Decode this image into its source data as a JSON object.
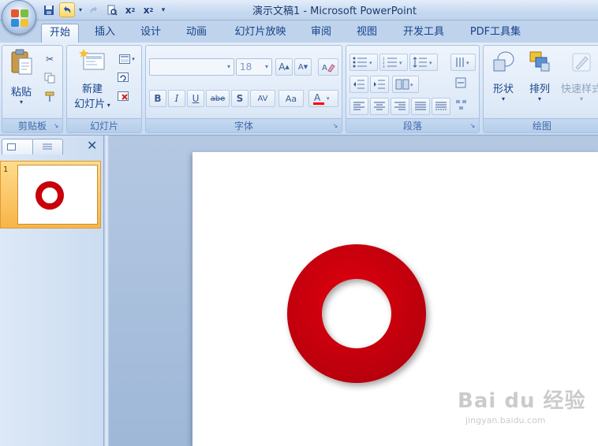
{
  "window": {
    "title": "演示文稿1 - Microsoft PowerPoint"
  },
  "quick_access": {
    "items": [
      {
        "name": "save-icon",
        "glyph": "▣"
      },
      {
        "name": "undo-icon",
        "glyph": "↶"
      },
      {
        "name": "redo-icon",
        "glyph": "↷"
      },
      {
        "name": "print-preview-icon",
        "glyph": "⌕"
      },
      {
        "name": "superscript-icon",
        "glyph": "x²"
      },
      {
        "name": "subscript-icon",
        "glyph": "x₂"
      },
      {
        "name": "customize-qat-icon",
        "glyph": "▾"
      }
    ]
  },
  "ribbon_tabs": [
    {
      "label": "开始",
      "active": true
    },
    {
      "label": "插入",
      "active": false
    },
    {
      "label": "设计",
      "active": false
    },
    {
      "label": "动画",
      "active": false
    },
    {
      "label": "幻灯片放映",
      "active": false
    },
    {
      "label": "审阅",
      "active": false
    },
    {
      "label": "视图",
      "active": false
    },
    {
      "label": "开发工具",
      "active": false
    },
    {
      "label": "PDF工具集",
      "active": false
    }
  ],
  "groups": {
    "clipboard": {
      "label": "剪贴板",
      "paste_label": "粘贴"
    },
    "slides": {
      "label": "幻灯片",
      "new_slide_line1": "新建",
      "new_slide_line2": "幻灯片"
    },
    "font": {
      "label": "字体",
      "font_name": "",
      "font_size": "18",
      "buttons": [
        "B",
        "I",
        "U",
        "abe",
        "S",
        "AV",
        "Aa"
      ],
      "grow": "A",
      "shrink": "A"
    },
    "paragraph": {
      "label": "段落"
    },
    "drawing": {
      "label": "绘图",
      "shapes_label": "形状",
      "arrange_label": "排列",
      "quick_styles_label": "快速样式"
    }
  },
  "slides_pane": {
    "slide_number": "1",
    "close_glyph": "✕"
  },
  "colors": {
    "ring_red": "#c8000a",
    "ribbon_blue": "#15428b"
  },
  "watermark": {
    "logo": "Bai du 经验",
    "url": "jingyan.baidu.com"
  }
}
